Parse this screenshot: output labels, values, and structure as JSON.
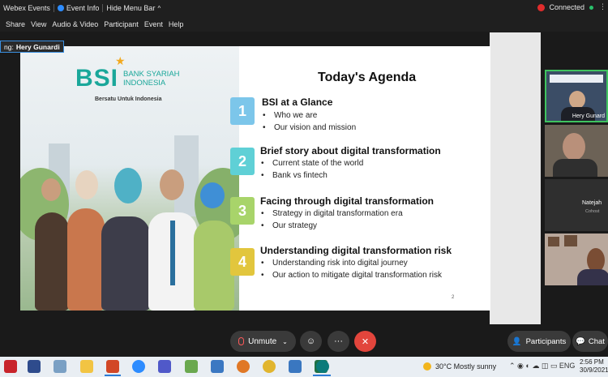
{
  "titlebar": {
    "app": "Webex Events",
    "event_info": "Event Info",
    "hide_menu": "Hide Menu Bar",
    "status": "Connected"
  },
  "menu": [
    "Share",
    "View",
    "Audio & Video",
    "Participant",
    "Event",
    "Help"
  ],
  "speaking": {
    "prefix": "ng:",
    "name": "Hery Gunardi"
  },
  "slide": {
    "bank_logo": "BSI",
    "bank_name_line1": "BANK SYARIAH",
    "bank_name_line2": "INDONESIA",
    "tagline": "Bersatu Untuk Indonesia",
    "agenda_title": "Today's Agenda",
    "page_number": "2",
    "items": [
      {
        "num": "1",
        "color": "#7cc6ea",
        "title": "BSI at a Glance",
        "points": [
          "Who we are",
          "Our vision and mission"
        ]
      },
      {
        "num": "2",
        "color": "#5fd0d6",
        "title": "Brief story about digital transformation",
        "points": [
          "Current state of the world",
          "Bank vs fintech"
        ]
      },
      {
        "num": "3",
        "color": "#a8d46a",
        "title": "Facing through digital transformation",
        "points": [
          "Strategy in digital transformation era",
          "Our strategy"
        ]
      },
      {
        "num": "4",
        "color": "#e2c63d",
        "title": "Understanding digital transformation risk",
        "points": [
          "Understanding risk into digital journey",
          "Our action to mitigate digital transformation risk"
        ]
      }
    ]
  },
  "participants": [
    {
      "name": "Hery Gunard",
      "role": ""
    },
    {
      "name": "",
      "role": ""
    },
    {
      "name": "Natejah",
      "role": "Cohost"
    },
    {
      "name": "",
      "role": ""
    }
  ],
  "controls": {
    "unmute": "Unmute",
    "participants": "Participants",
    "chat": "Chat"
  },
  "taskbar": {
    "weather": "30°C  Mostly sunny",
    "lang": "ENG",
    "time": "2:56 PM",
    "date": "30/9/2021"
  }
}
